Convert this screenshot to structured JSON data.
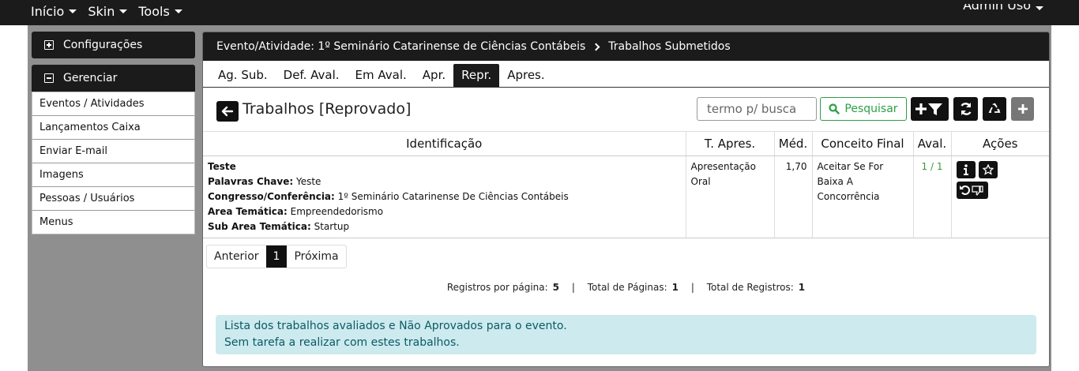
{
  "topnav": {
    "items": [
      {
        "label": "Início"
      },
      {
        "label": "Skin"
      },
      {
        "label": "Tools"
      }
    ],
    "user_label": "Admin Uso"
  },
  "sidebar": {
    "config_label": "Configurações",
    "manage_label": "Gerenciar",
    "items": [
      {
        "label": "Eventos / Atividades"
      },
      {
        "label": "Lançamentos Caixa"
      },
      {
        "label": "Enviar E-mail"
      },
      {
        "label": "Imagens"
      },
      {
        "label": "Pessoas / Usuários"
      },
      {
        "label": "Menus"
      }
    ]
  },
  "main": {
    "breadcrumb": {
      "event": "Evento/Atividade: 1º Seminário Catarinense de Ciências Contábeis",
      "current": "Trabalhos Submetidos"
    },
    "tabs": [
      {
        "label": "Ag. Sub."
      },
      {
        "label": "Def. Aval."
      },
      {
        "label": "Em Aval."
      },
      {
        "label": "Apr."
      },
      {
        "label": "Repr."
      },
      {
        "label": "Apres."
      }
    ],
    "active_tab": "Repr.",
    "page_title": "Trabalhos [Reprovado]",
    "search": {
      "placeholder": "termo p/ busca",
      "button_label": "Pesquisar"
    },
    "table": {
      "headers": [
        "Identificação",
        "T. Apres.",
        "Méd.",
        "Conceito Final",
        "Aval.",
        "Ações"
      ],
      "rows": [
        {
          "title": "Teste",
          "keywords_label": "Palavras Chave:",
          "keywords": "Yeste",
          "congress_label": "Congresso/Conferência:",
          "congress": "1º Seminário Catarinense De Ciências Contábeis",
          "area_label": "Area Temática:",
          "area": "Empreendedorismo",
          "subarea_label": "Sub Area Temática:",
          "subarea": "Startup",
          "presentation_type": "Apresentação Oral",
          "average": "1,70",
          "final_concept": "Aceitar Se For Baixa A Concorrência",
          "evaluations": "1 / 1"
        }
      ]
    },
    "pager": {
      "prev_label": "Anterior",
      "current_page": "1",
      "next_label": "Próxima"
    },
    "stats": {
      "per_page_label": "Registros por página:",
      "per_page": "5",
      "pages_label": "Total de Páginas:",
      "pages": "1",
      "records_label": "Total de Registros:",
      "records": "1",
      "separator": "|"
    },
    "info": {
      "line1": "Lista dos trabalhos avaliados e Não Aprovados para o evento.",
      "line2": "Sem tarefa a realizar com estes trabalhos."
    }
  },
  "colors": {
    "dark": "#1b1b1b",
    "accent_green": "#2e9e46",
    "info_bg": "#cdeaee"
  }
}
